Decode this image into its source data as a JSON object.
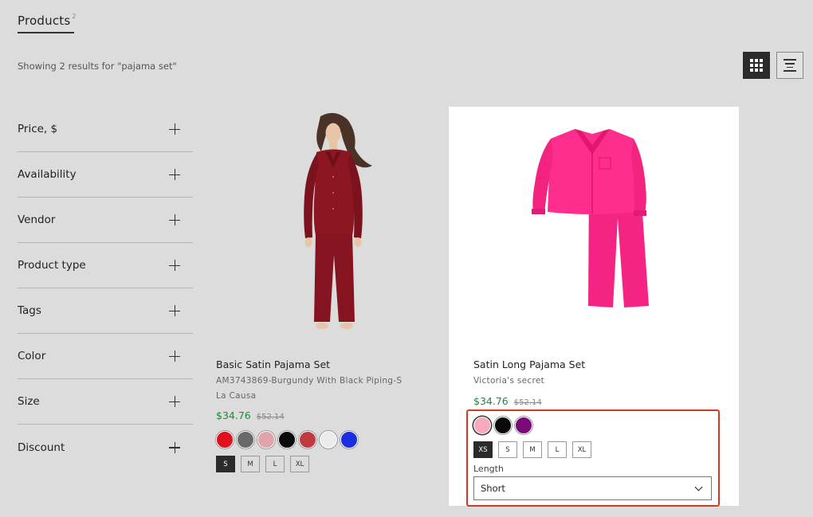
{
  "header": {
    "title": "Products",
    "count": "2",
    "results_text": "Showing 2 results for \"pajama set\""
  },
  "view_toggle": {
    "grid_icon": "grid-icon",
    "list_icon": "list-icon"
  },
  "filters": [
    {
      "label": "Price, $"
    },
    {
      "label": "Availability"
    },
    {
      "label": "Vendor"
    },
    {
      "label": "Product type"
    },
    {
      "label": "Tags"
    },
    {
      "label": "Color"
    },
    {
      "label": "Size"
    },
    {
      "label": "Discount"
    }
  ],
  "products": [
    {
      "title": "Basic Satin Pajama Set",
      "sku": "AM3743869-Burgundy With Black Piping-S",
      "vendor": "La Causa",
      "price": "$34.76",
      "compare_price": "$52.14",
      "swatches": [
        "#e0101c",
        "#6a6a6a",
        "#e1a3ab",
        "#0a0a0a",
        "#c03a40",
        "#ececec",
        "#1a2de0"
      ],
      "sizes": [
        "S",
        "M",
        "L",
        "XL"
      ],
      "selected_size": "S"
    },
    {
      "title": "Satin Long Pajama Set",
      "vendor": "Victoria's secret",
      "price": "$34.76",
      "compare_price": "$52.14",
      "swatches": [
        "#f7a9bd",
        "#0a0a0a",
        "#7a0a78"
      ],
      "sizes": [
        "XS",
        "S",
        "M",
        "L",
        "XL"
      ],
      "selected_size": "XS",
      "length_label": "Length",
      "length_value": "Short"
    }
  ],
  "colors": {
    "price_green": "#1b8a3d",
    "highlight_red": "#d43a22",
    "product1_fabric": "#8c1622",
    "product2_fabric": "#ff2d8e"
  }
}
